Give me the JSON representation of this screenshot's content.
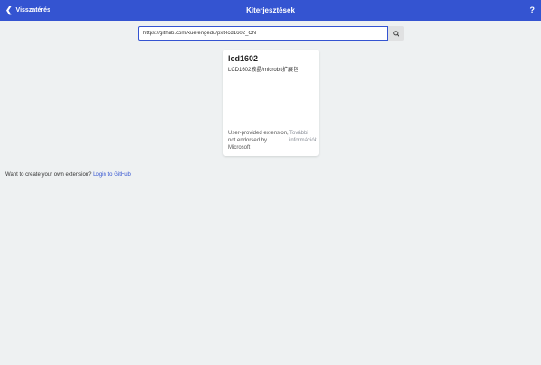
{
  "header": {
    "back_label": "Visszatérés",
    "title": "Kiterjesztések",
    "help_label": "?"
  },
  "search": {
    "value": "https://github.com/xuefengedu/pxt-lcd1602_CN"
  },
  "card": {
    "title": "lcd1602",
    "description": "LCD1602液晶/microbit扩展包",
    "note": "User-provided extension, not endorsed by Microsoft",
    "link_label": "További információk"
  },
  "footer": {
    "prompt": "Want to create your own extension?",
    "link_label": "Login to GitHub"
  },
  "colors": {
    "header_bg": "#3454d1",
    "page_bg": "#eef1f2",
    "link": "#3454d1"
  },
  "icons": {
    "back": "chevron-left-icon",
    "search": "search-icon"
  }
}
